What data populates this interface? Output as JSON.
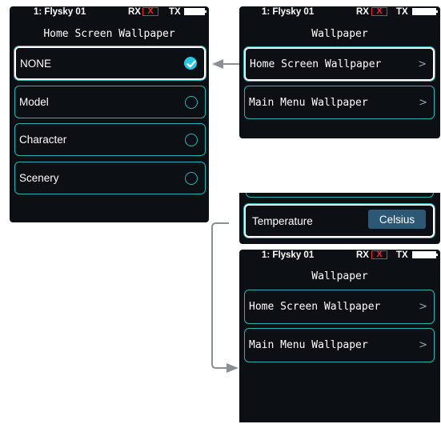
{
  "status": {
    "model": "1: Flysky 01",
    "rx": "RX",
    "rx_state": "X",
    "tx": "TX"
  },
  "left_screen": {
    "title": "Home Screen Wallpaper",
    "options": [
      {
        "label": "NONE",
        "selected": true
      },
      {
        "label": "Model",
        "selected": false
      },
      {
        "label": "Character",
        "selected": false
      },
      {
        "label": "Scenery",
        "selected": false
      }
    ]
  },
  "top_right_screen": {
    "title": "Wallpaper",
    "items": [
      {
        "label": "Home Screen Wallpaper",
        "chevron": ">"
      },
      {
        "label": "Main Menu Wallpaper",
        "chevron": ">"
      }
    ]
  },
  "temperature_row": {
    "label": "Temperature",
    "value": "Celsius"
  },
  "bottom_right_screen": {
    "title": "Wallpaper",
    "items": [
      {
        "label": "Home Screen Wallpaper",
        "chevron": ">"
      },
      {
        "label": "Main Menu Wallpaper",
        "chevron": ">"
      }
    ]
  },
  "colors": {
    "screen_bg": "#0c0f13",
    "accent_teal": "#29b5b5",
    "check_blue": "#29c5e0",
    "unit_button": "#2c5876",
    "rx_error": "#e53030",
    "arrow_gray": "#8a8f94"
  }
}
